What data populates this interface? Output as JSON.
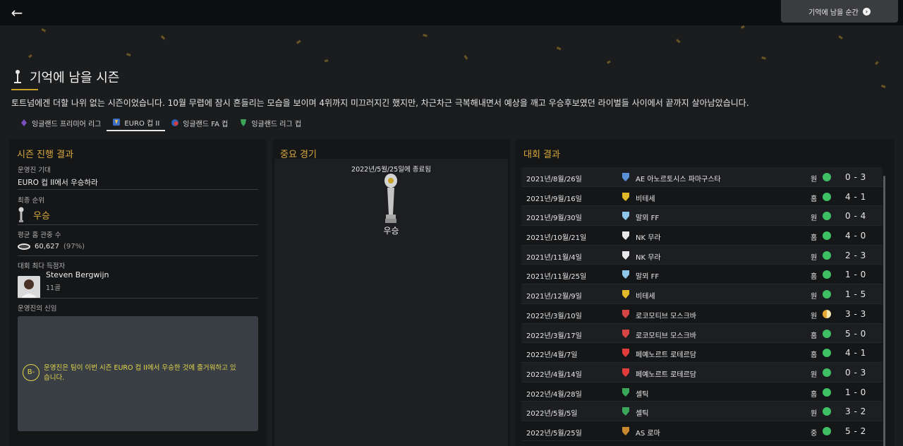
{
  "header": {
    "back_label": "←",
    "memorable_button": "기억에 남을 순간",
    "title": "기억에 남을 시즌",
    "description": "토트넘에겐 더할 나위 없는 시즌이었습니다. 10월 무렵에 잠시 흔들리는 모습을 보이며 4위까지 미끄러지긴 했지만, 차근차근 극복해내면서 예상을 깨고 우승후보였던 라이벌들 사이에서 끝까지 살아남았습니다."
  },
  "competition_tabs": [
    {
      "label": "잉글랜드 프리미어 리그",
      "icon": "premier-league-icon",
      "active": false
    },
    {
      "label": "EURO 컵 II",
      "icon": "euro-cup-icon",
      "active": true
    },
    {
      "label": "잉글랜드 FA 컵",
      "icon": "fa-cup-icon",
      "active": false
    },
    {
      "label": "잉글랜드 리그 컵",
      "icon": "league-cup-icon",
      "active": false
    }
  ],
  "season_progress": {
    "title": "시즌 진행 결과",
    "expectation_label": "운영진 기대",
    "expectation_value": "EURO 컵 II에서 우승하라",
    "final_position_label": "최종 순위",
    "final_position_value": "우승",
    "avg_attendance_label": "평균 홈 관중 수",
    "avg_attendance_value": "60,627",
    "avg_attendance_pct": "(97%)",
    "top_scorer_label": "대회 최다 득점자",
    "top_scorer_name": "Steven Bergwijn",
    "top_scorer_goals": "11골",
    "board_confidence_label": "운영진의 신임",
    "board_confidence_grade": "B-",
    "board_confidence_text": "운영진은 팀이 이번 시즌 EURO 컵 II에서 우승한 것에 즐거워하고 있습니다."
  },
  "key_match": {
    "title": "중요 경기",
    "date_text": "2022년/5월/25일에 종료됨",
    "result": "우승"
  },
  "results": {
    "title": "대회 결과",
    "colors": {
      "win": "#3fbf63",
      "draw": "#e8a934"
    },
    "rows": [
      {
        "date": "2021년/8월/26일",
        "opponent": "AE 아노르토시스 파마구스타",
        "venue": "원",
        "outcome": "win",
        "score": "0 - 3",
        "crest_color": "#5b8fd6"
      },
      {
        "date": "2021년/9월/16일",
        "opponent": "비테세",
        "venue": "홈",
        "outcome": "win",
        "score": "4 - 1",
        "crest_color": "#e0b82a"
      },
      {
        "date": "2021년/9월/30일",
        "opponent": "말뫼 FF",
        "venue": "원",
        "outcome": "win",
        "score": "0 - 4",
        "crest_color": "#8ec6ea"
      },
      {
        "date": "2021년/10월/21일",
        "opponent": "NK 무라",
        "venue": "홈",
        "outcome": "win",
        "score": "4 - 0",
        "crest_color": "#e8e8e8"
      },
      {
        "date": "2021년/11월/4일",
        "opponent": "NK 무라",
        "venue": "원",
        "outcome": "win",
        "score": "2 - 3",
        "crest_color": "#e8e8e8"
      },
      {
        "date": "2021년/11월/25일",
        "opponent": "말뫼 FF",
        "venue": "홈",
        "outcome": "win",
        "score": "1 - 0",
        "crest_color": "#8ec6ea"
      },
      {
        "date": "2021년/12월/9일",
        "opponent": "비테세",
        "venue": "원",
        "outcome": "win",
        "score": "1 - 5",
        "crest_color": "#e0b82a"
      },
      {
        "date": "2022년/3월/10일",
        "opponent": "로코모티브 모스크바",
        "venue": "원",
        "outcome": "draw",
        "score": "3 - 3",
        "crest_color": "#d64545"
      },
      {
        "date": "2022년/3월/17일",
        "opponent": "로코모티브 모스크바",
        "venue": "홈",
        "outcome": "win",
        "score": "5 - 0",
        "crest_color": "#d64545"
      },
      {
        "date": "2022년/4월/7일",
        "opponent": "페예노르트 로테르담",
        "venue": "홈",
        "outcome": "win",
        "score": "4 - 1",
        "crest_color": "#e23b3b"
      },
      {
        "date": "2022년/4월/14일",
        "opponent": "페예노르트 로테르담",
        "venue": "원",
        "outcome": "win",
        "score": "0 - 3",
        "crest_color": "#e23b3b"
      },
      {
        "date": "2022년/4월/28일",
        "opponent": "셀틱",
        "venue": "홈",
        "outcome": "win",
        "score": "1 - 0",
        "crest_color": "#3aa65a"
      },
      {
        "date": "2022년/5월/5일",
        "opponent": "셀틱",
        "venue": "원",
        "outcome": "win",
        "score": "3 - 2",
        "crest_color": "#3aa65a"
      },
      {
        "date": "2022년/5월/25일",
        "opponent": "AS 로마",
        "venue": "중",
        "outcome": "win",
        "score": "5 - 2",
        "crest_color": "#c8882e"
      }
    ]
  }
}
